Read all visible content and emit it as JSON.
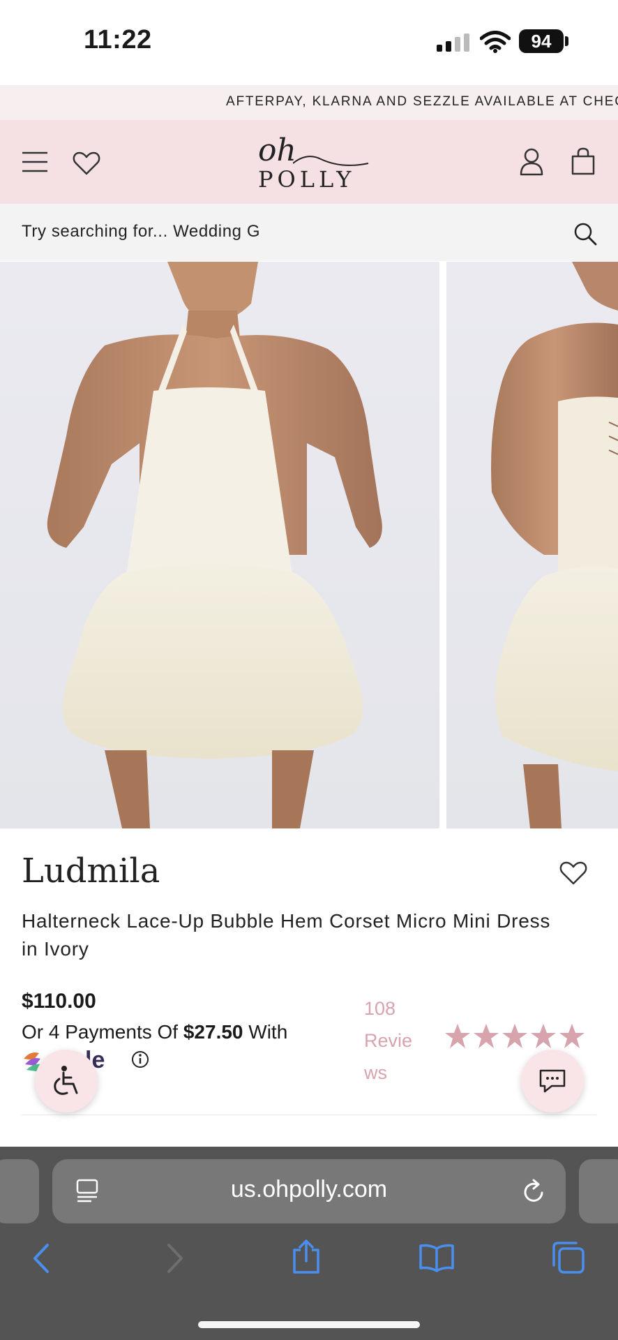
{
  "status_bar": {
    "time": "11:22",
    "battery": "94"
  },
  "promo": {
    "text": "AFTERPAY, KLARNA AND SEZZLE AVAILABLE AT CHEC"
  },
  "header": {
    "logo_script": "oh",
    "logo_text": "POLLY"
  },
  "search": {
    "placeholder": "Try searching for...  Wedding G"
  },
  "product": {
    "name": "Ludmila",
    "description": "Halterneck Lace-Up Bubble Hem Corset Micro Mini Dress in Ivory",
    "price": "$110.00",
    "payments_prefix": "Or 4 Payments Of ",
    "payments_amount": "$27.50",
    "payments_suffix": " With",
    "provider_partial": "zzle",
    "review_count": "108",
    "review_word_1": "Revie",
    "review_word_2": "ws",
    "rating_stars": 5
  },
  "browser": {
    "url": "us.ohpolly.com"
  },
  "colors": {
    "accent_pink": "#f5e1e4",
    "star_pink": "#d7a3ad",
    "browser_gray": "#545454",
    "safari_blue": "#4a8ef0"
  }
}
